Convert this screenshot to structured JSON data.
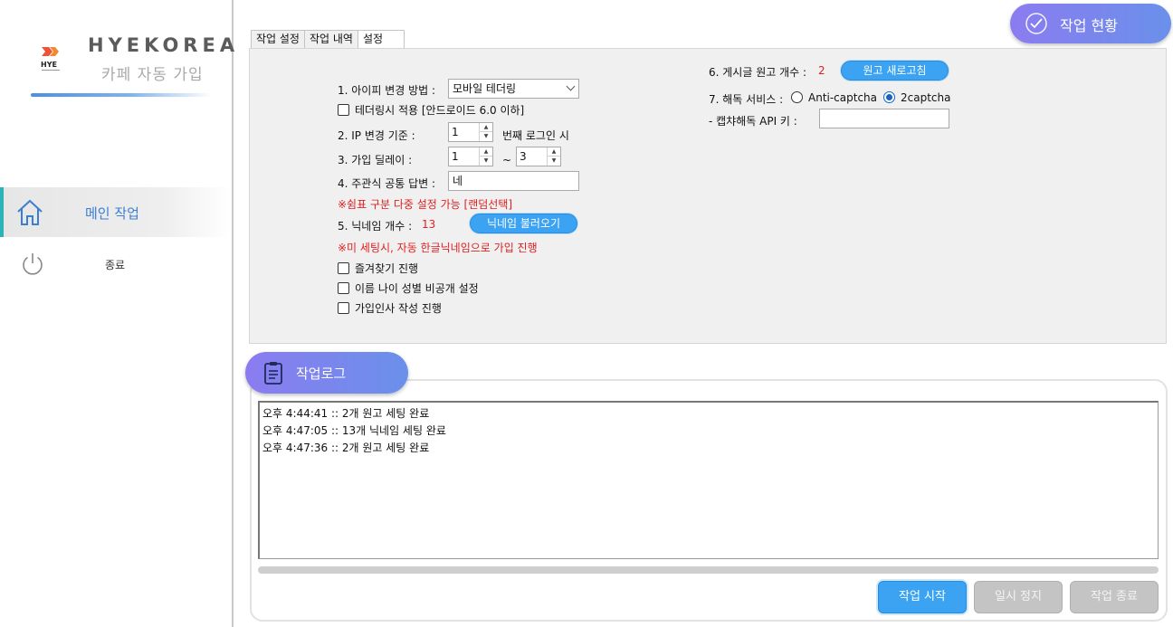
{
  "brand": {
    "logo_text": "HYE",
    "name": "HYEKOREA",
    "subtitle": "카페 자동 가입"
  },
  "sidebar": {
    "items": [
      {
        "label": "메인 작업",
        "icon": "home-icon",
        "active": true
      },
      {
        "label": "종료",
        "icon": "power-icon",
        "active": false
      }
    ]
  },
  "status_pill": {
    "label": "작업 현황",
    "icon": "check-circle-icon"
  },
  "tabs": [
    {
      "label": "작업 설정",
      "active": false
    },
    {
      "label": "작업 내역",
      "active": false
    },
    {
      "label": "설정",
      "active": true
    }
  ],
  "settings": {
    "ip_method_label": "1. 아이피 변경 방법 :",
    "ip_method_value": "모바일 테더링",
    "tether_check_label": "테더링시 적용 [안드로이드 6.0 이하]",
    "ip_change_label": "2. IP 변경 기준 :",
    "ip_change_value": "1",
    "ip_change_suffix": "번째 로그인 시",
    "delay_label": "3. 가입 딜레이 :",
    "delay_min": "1",
    "delay_sep": "~",
    "delay_max": "3",
    "answer_label": "4. 주관식 공통 답변 :",
    "answer_value": "네",
    "answer_note": "※쉼표 구분 다중 설정 가능 [랜덤선택]",
    "nickname_label": "5. 닉네임 개수 :",
    "nickname_count": "13",
    "nickname_button": "닉네임 불러오기",
    "nickname_note": "※미 세팅시, 자동 한글닉네임으로 가입 진행",
    "favorite_label": "즐겨찾기 진행",
    "private_label": "이름 나이 성별 비공개 설정",
    "greeting_label": "가입인사 작성 진행",
    "post_label": "6. 게시글 원고 개수 :",
    "post_count": "2",
    "post_button": "원고 새로고침",
    "captcha_label": "7. 해독 서비스 :",
    "captcha_options": [
      "Anti-captcha",
      "2captcha"
    ],
    "captcha_selected": "2captcha",
    "api_key_label": "- 캡챠해독 API 키 :",
    "api_key_value": ""
  },
  "log": {
    "title": "작업로그",
    "icon": "clipboard-icon",
    "lines": [
      "오후 4:44:41 ::  2개 원고 세팅 완료",
      "오후 4:47:05 ::  13개 닉네임 세팅 완료",
      "오후 4:47:36 ::  2개 원고 세팅 완료"
    ]
  },
  "actions": {
    "start": "작업 시작",
    "pause": "일시 정지",
    "stop": "작업 종료"
  },
  "colors": {
    "accent_blue": "#3ba3f2",
    "pill_gradient_start": "#8b7cf0",
    "pill_gradient_end": "#6a90ea",
    "nav_active_bar": "#2ab4b8",
    "warning_red": "#e02020"
  }
}
